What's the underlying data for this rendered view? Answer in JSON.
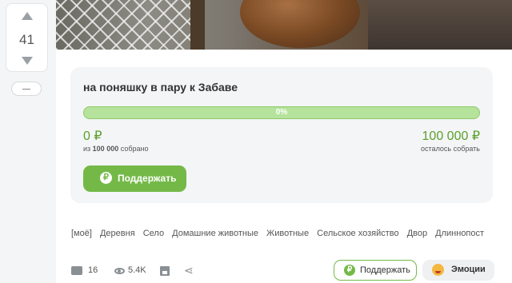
{
  "vote": {
    "count": "41"
  },
  "donation": {
    "title": "на поняшку в пару к Забаве",
    "progress_percent": 0,
    "progress_label": "0%",
    "collected_amount": "0 ₽",
    "collected_prefix": "из",
    "collected_goal": "100 000",
    "collected_suffix": "собрано",
    "remaining_amount": "100 000 ₽",
    "remaining_label": "осталось собрать",
    "support_button_label": "Поддержать",
    "currency_glyph": "₽"
  },
  "tags": [
    "[моё]",
    "Деревня",
    "Село",
    "Домашние животные",
    "Животные",
    "Сельское хозяйство",
    "Двор",
    "Длиннопост"
  ],
  "footer": {
    "comments_count": "16",
    "views_count": "5.4K",
    "share_glyph": "⋖",
    "support_label": "Поддержать",
    "emotions_label": "Эмоции"
  },
  "colors": {
    "accent_green": "#74b948",
    "progress_fill": "#b6e39c",
    "amount_green": "#5aa02c"
  }
}
